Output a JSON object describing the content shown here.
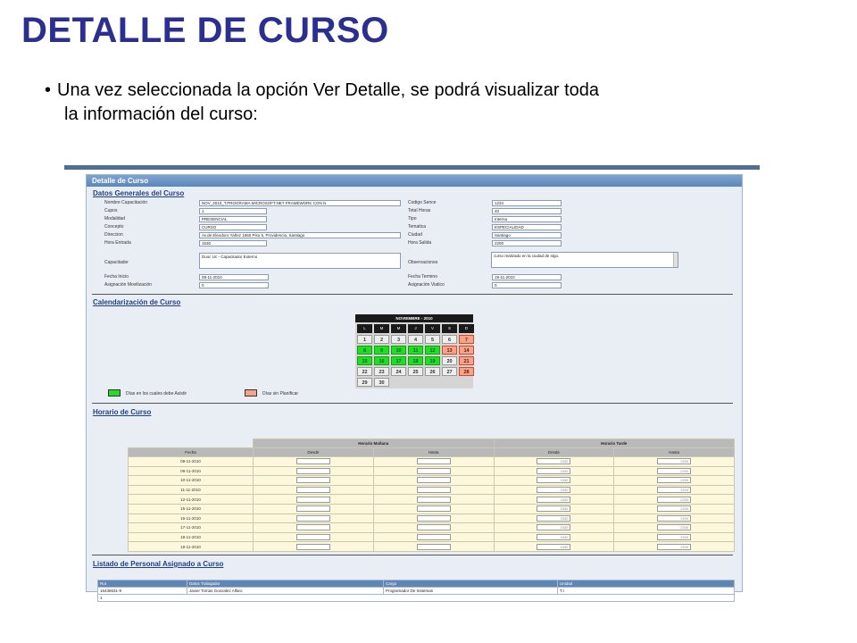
{
  "slide": {
    "title": "DETALLE DE CURSO",
    "bullet": "•",
    "line1": "Una vez seleccionada la opción Ver Detalle, se podrá visualizar toda",
    "line2": "la información del curso:"
  },
  "panel": {
    "title": "Detalle de Curso",
    "general": {
      "section_title": "Datos Generales del Curso",
      "left": [
        {
          "label": "Nombre Capacitación",
          "value": "NOV_2010_T.PROGRAMA.MICROSOFT.NET FRAMEWORK CON N"
        },
        {
          "label": "Cupos",
          "value": "1"
        },
        {
          "label": "Modalidad",
          "value": "PRESENCIAL"
        },
        {
          "label": "Concepto",
          "value": "CURSO"
        },
        {
          "label": "Direccion",
          "value": "Av.de Eleodoro Yañez 1560 Piso 5, Providencia, Santiago"
        },
        {
          "label": "Hora Entrada",
          "value": "1530"
        }
      ],
      "right": [
        {
          "label": "Codigo Sence",
          "value": "1234"
        },
        {
          "label": "Total Horas",
          "value": "40"
        },
        {
          "label": "Tipo",
          "value": "Interna"
        },
        {
          "label": "Tematica",
          "value": "ESPECIALIDAD"
        },
        {
          "label": "Ciudad",
          "value": "Santiago"
        },
        {
          "label": "Hora Salida",
          "value": "2200"
        }
      ],
      "capacitador_label": "Capacitador",
      "capacitador_value": "Duoc Uc - Capacitador Externo",
      "observaciones_label": "Observaciones",
      "observaciones_value": "curso realizado en la ciudad de stgo.",
      "fecha_inicio_label": "Fecha Inicio",
      "fecha_inicio_value": "08-11-2010",
      "asig_mov_label": "Asignación Movilización",
      "asig_mov_value": "0",
      "fecha_termino_label": "Fecha Termino",
      "fecha_termino_value": "19-11-2010",
      "asig_viat_label": "Asignación Viatico",
      "asig_viat_value": "0"
    },
    "calendar": {
      "section_title": "Calendarización de Curso",
      "month": "NOVIEMBRE - 2010",
      "day_names": [
        "L",
        "M",
        "M",
        "J",
        "V",
        "S",
        "D"
      ],
      "legend_green": "Días en los cuales debe Asistir",
      "legend_orange": "Días sin Planificar",
      "green_color": "#22dd22",
      "orange_color": "#f6a389",
      "weeks": [
        [
          {
            "d": "1",
            "s": "n"
          },
          {
            "d": "2",
            "s": "n"
          },
          {
            "d": "3",
            "s": "n"
          },
          {
            "d": "4",
            "s": "n"
          },
          {
            "d": "5",
            "s": "n"
          },
          {
            "d": "6",
            "s": "n"
          },
          {
            "d": "7",
            "s": "r"
          }
        ],
        [
          {
            "d": "8",
            "s": "g"
          },
          {
            "d": "9",
            "s": "g"
          },
          {
            "d": "10",
            "s": "g"
          },
          {
            "d": "11",
            "s": "g"
          },
          {
            "d": "12",
            "s": "g"
          },
          {
            "d": "13",
            "s": "r"
          },
          {
            "d": "14",
            "s": "r"
          }
        ],
        [
          {
            "d": "15",
            "s": "g"
          },
          {
            "d": "16",
            "s": "g"
          },
          {
            "d": "17",
            "s": "g"
          },
          {
            "d": "18",
            "s": "g"
          },
          {
            "d": "19",
            "s": "g"
          },
          {
            "d": "20",
            "s": "n"
          },
          {
            "d": "21",
            "s": "r"
          }
        ],
        [
          {
            "d": "22",
            "s": "n"
          },
          {
            "d": "23",
            "s": "n"
          },
          {
            "d": "24",
            "s": "n"
          },
          {
            "d": "25",
            "s": "n"
          },
          {
            "d": "26",
            "s": "n"
          },
          {
            "d": "27",
            "s": "n"
          },
          {
            "d": "28",
            "s": "r"
          }
        ],
        [
          {
            "d": "29",
            "s": "n"
          },
          {
            "d": "30",
            "s": "n"
          },
          {
            "d": "",
            "s": "e"
          },
          {
            "d": "",
            "s": "e"
          },
          {
            "d": "",
            "s": "e"
          },
          {
            "d": "",
            "s": "e"
          },
          {
            "d": "",
            "s": "e"
          }
        ]
      ]
    },
    "horario": {
      "section_title": "Horario de Curso",
      "group_morning": "Horario Mañana",
      "group_afternoon": "Horario Tarde",
      "col_fecha": "Fecha",
      "col_desde": "Desde",
      "col_hasta": "Hasta",
      "rows": [
        {
          "fecha": "08-11-2010",
          "tdesde": "1530",
          "thasta": "2200"
        },
        {
          "fecha": "09-11-2010",
          "tdesde": "1530",
          "thasta": "2200"
        },
        {
          "fecha": "10-11-2010",
          "tdesde": "1530",
          "thasta": "2200"
        },
        {
          "fecha": "11-11-2010",
          "tdesde": "1530",
          "thasta": "2200"
        },
        {
          "fecha": "12-11-2010",
          "tdesde": "1530",
          "thasta": "2200"
        },
        {
          "fecha": "15-11-2010",
          "tdesde": "1530",
          "thasta": "2200"
        },
        {
          "fecha": "16-11-2010",
          "tdesde": "1530",
          "thasta": "2200"
        },
        {
          "fecha": "17-11-2010",
          "tdesde": "1530",
          "thasta": "2200"
        },
        {
          "fecha": "18-11-2010",
          "tdesde": "1530",
          "thasta": "2200"
        },
        {
          "fecha": "19-11-2010",
          "tdesde": "1530",
          "thasta": "2200"
        }
      ]
    },
    "personal": {
      "section_title": "Listado de Personal Asignado a Curso",
      "headers": [
        "Rut",
        "Datos Trabajador",
        "Cargo",
        "Unidad"
      ],
      "rows": [
        [
          "16436631-9",
          "Javier Tomas Gonzalez Alfaro",
          "Programador De Sistemas",
          "T.I"
        ]
      ],
      "page": "1"
    }
  }
}
